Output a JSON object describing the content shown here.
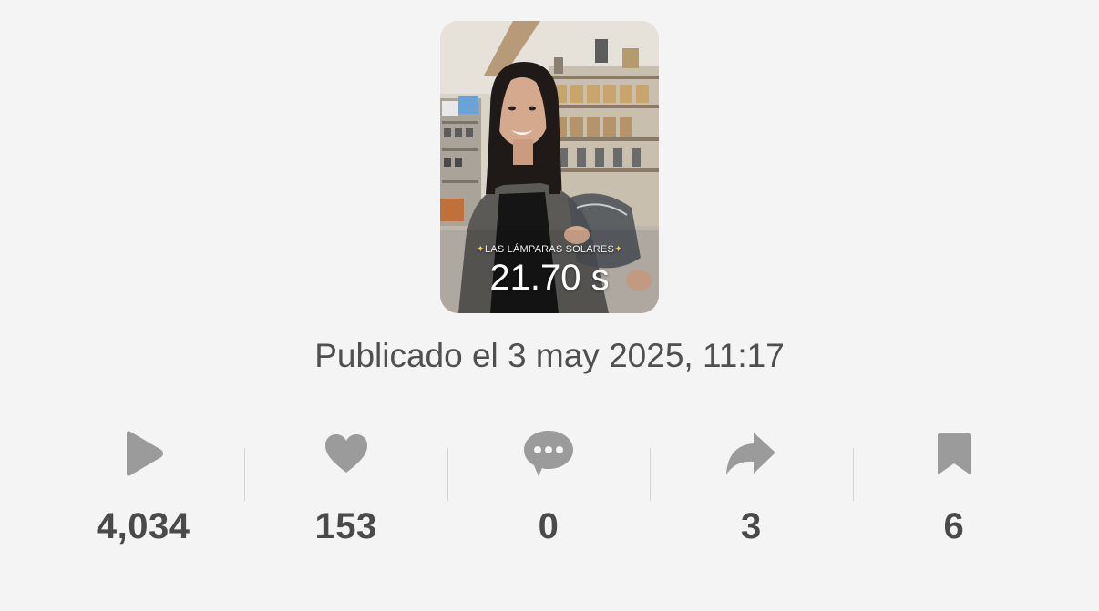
{
  "video": {
    "overlay_caption": "LAS LÁMPARAS SOLARES",
    "duration": "21.70 s"
  },
  "published": "Publicado el 3 may 2025, 11:17",
  "stats": {
    "views": {
      "icon": "play-icon",
      "value": "4,034"
    },
    "likes": {
      "icon": "heart-icon",
      "value": "153"
    },
    "comments": {
      "icon": "comment-icon",
      "value": "0"
    },
    "shares": {
      "icon": "share-icon",
      "value": "3"
    },
    "saves": {
      "icon": "bookmark-icon",
      "value": "6"
    }
  },
  "colors": {
    "background": "#f4f4f4",
    "icon": "#9b9b9b",
    "value_text": "#4a4a4a",
    "published_text": "#4f4f4f",
    "divider": "#d4d4d4"
  }
}
